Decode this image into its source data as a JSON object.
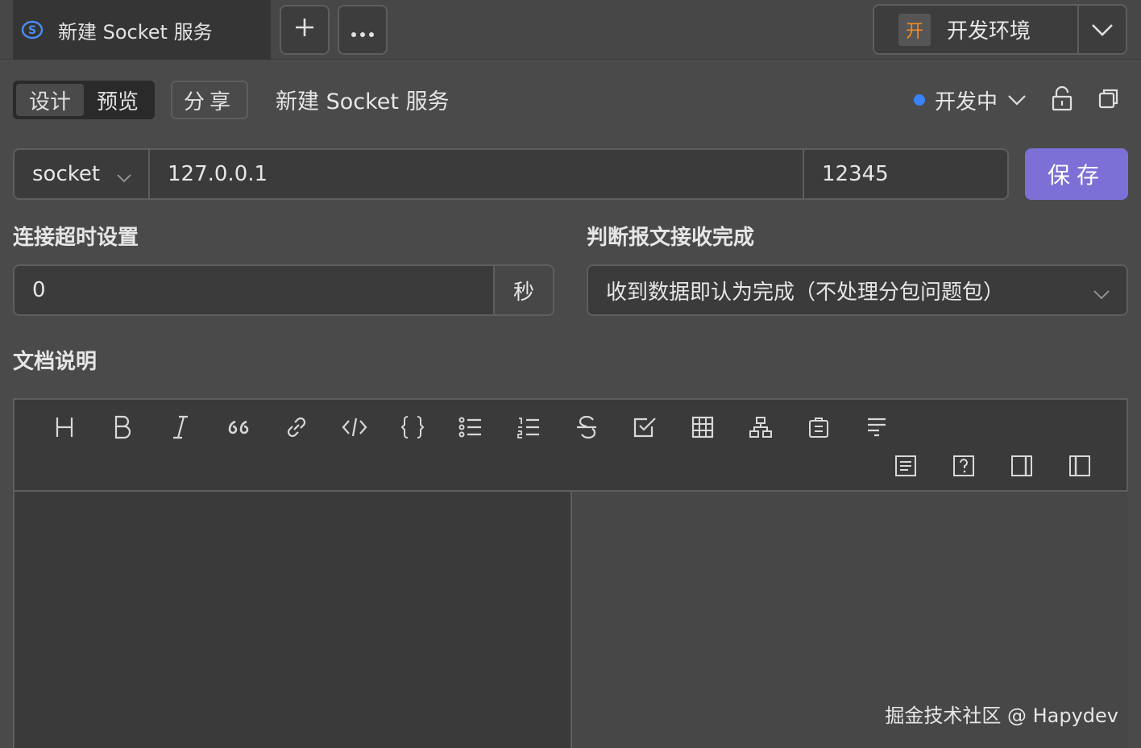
{
  "tab": {
    "label": "新建 Socket 服务"
  },
  "env": {
    "badge": "开",
    "label": "开发环境"
  },
  "toolbar": {
    "design_label": "设计",
    "preview_label": "预览",
    "share_label": "分享",
    "page_title": "新建 Socket 服务",
    "status_label": "开发中",
    "status_color": "#3b82f6"
  },
  "request": {
    "protocol": "socket",
    "host": "127.0.0.1",
    "port": "12345",
    "save_label": "保存"
  },
  "settings": {
    "timeout_label": "连接超时设置",
    "timeout_value": "0",
    "timeout_unit": "秒",
    "complete_label": "判断报文接收完成",
    "complete_value": "收到数据即认为完成（不处理分包问题包）"
  },
  "docs": {
    "label": "文档说明",
    "toolbar_icons": [
      "heading-icon",
      "bold-icon",
      "italic-icon",
      "quote-icon",
      "link-icon",
      "code-icon",
      "code-block-icon",
      "bullet-list-icon",
      "ordered-list-icon",
      "strikethrough-icon",
      "checkbox-icon",
      "table-icon",
      "diagram-icon",
      "clipboard-icon",
      "align-icon",
      "toc-icon",
      "help-icon",
      "preview-pane-icon",
      "edit-pane-icon"
    ]
  },
  "watermark": "掘金技术社区 @ Hapydev",
  "colors": {
    "accent": "#7c6fd6",
    "env_badge": "#f08a24"
  }
}
